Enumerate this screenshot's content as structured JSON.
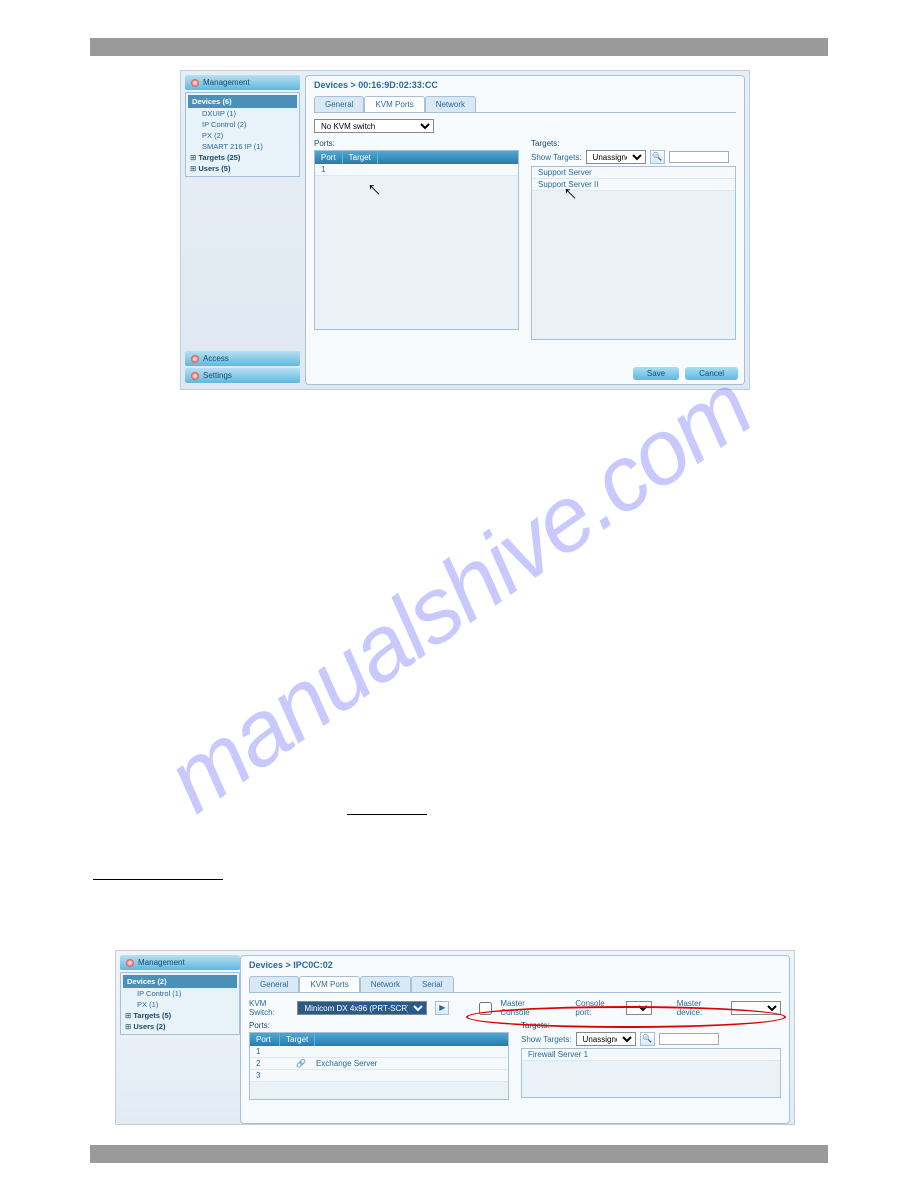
{
  "watermark": "manualshive.com",
  "fig1": {
    "sidebar": {
      "management": "Management",
      "devices_root": "Devices (6)",
      "items": [
        "DXUIP (1)",
        "IP Control (2)",
        "PX (2)",
        "SMART 216 IP (1)"
      ],
      "targets": "Targets (25)",
      "users": "Users (5)",
      "access": "Access",
      "settings": "Settings"
    },
    "breadcrumb": "Devices > 00:16:9D:02:33:CC",
    "tabs": [
      "General",
      "KVM Ports",
      "Network"
    ],
    "active_tab": 1,
    "switch_select": "No KVM switch",
    "ports": {
      "label": "Ports:",
      "col_port": "Port",
      "col_target": "Target",
      "rows": [
        {
          "port": "1"
        }
      ]
    },
    "targets": {
      "label": "Targets:",
      "show_label": "Show Targets:",
      "filter_value": "Unassigned",
      "rows": [
        "Support Server",
        "Support Server II"
      ]
    },
    "save": "Save",
    "cancel": "Cancel"
  },
  "fig2": {
    "sidebar": {
      "management": "Management",
      "devices_root": "Devices (2)",
      "items": [
        "IP Control (1)",
        "PX (1)"
      ],
      "targets": "Targets (5)",
      "users": "Users (2)"
    },
    "breadcrumb": "Devices > IPC0C:02",
    "tabs": [
      "General",
      "KVM Ports",
      "Network",
      "Serial"
    ],
    "active_tab": 1,
    "kvm_label": "KVM Switch:",
    "kvm_value": "Minicom DX 4x96 (PRT-SCR)",
    "master_console": "Master Console",
    "console_port": "Console port:",
    "master_device": "Master device:",
    "ports": {
      "label": "Ports:",
      "col_port": "Port",
      "col_target": "Target",
      "rows": [
        {
          "port": "1",
          "target": ""
        },
        {
          "port": "2",
          "target": "Exchange Server",
          "linked": true
        },
        {
          "port": "3",
          "target": ""
        }
      ]
    },
    "targets": {
      "label": "Targets:",
      "show_label": "Show Targets:",
      "filter_value": "Unassigned",
      "rows": [
        "Firewall Server 1"
      ]
    }
  }
}
